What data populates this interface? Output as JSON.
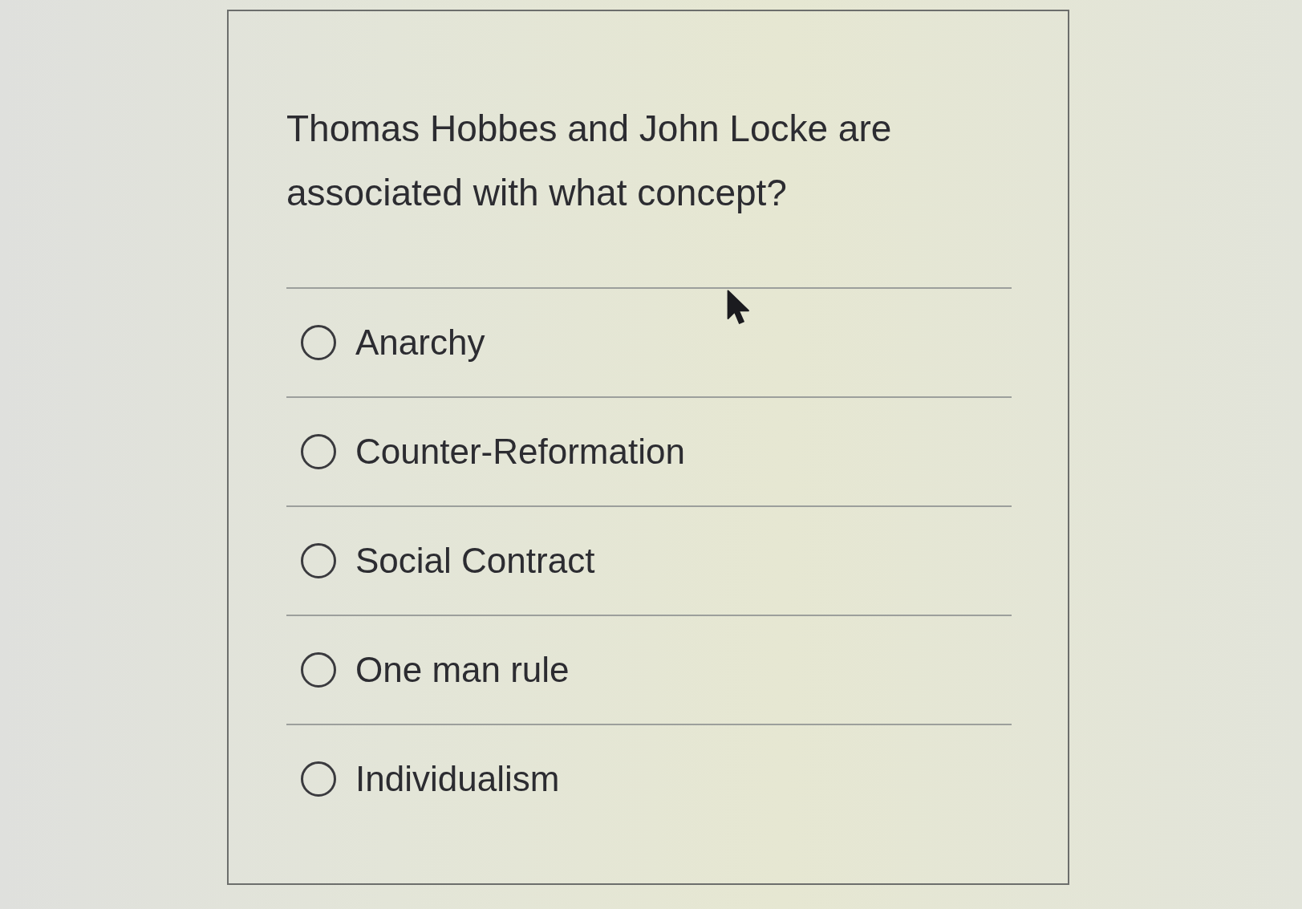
{
  "question": {
    "text": "Thomas Hobbes and John Locke are associated with what concept?"
  },
  "options": [
    {
      "label": "Anarchy",
      "selected": false
    },
    {
      "label": "Counter-Reformation",
      "selected": false
    },
    {
      "label": "Social Contract",
      "selected": false
    },
    {
      "label": "One man rule",
      "selected": false
    },
    {
      "label": "Individualism",
      "selected": false
    }
  ]
}
